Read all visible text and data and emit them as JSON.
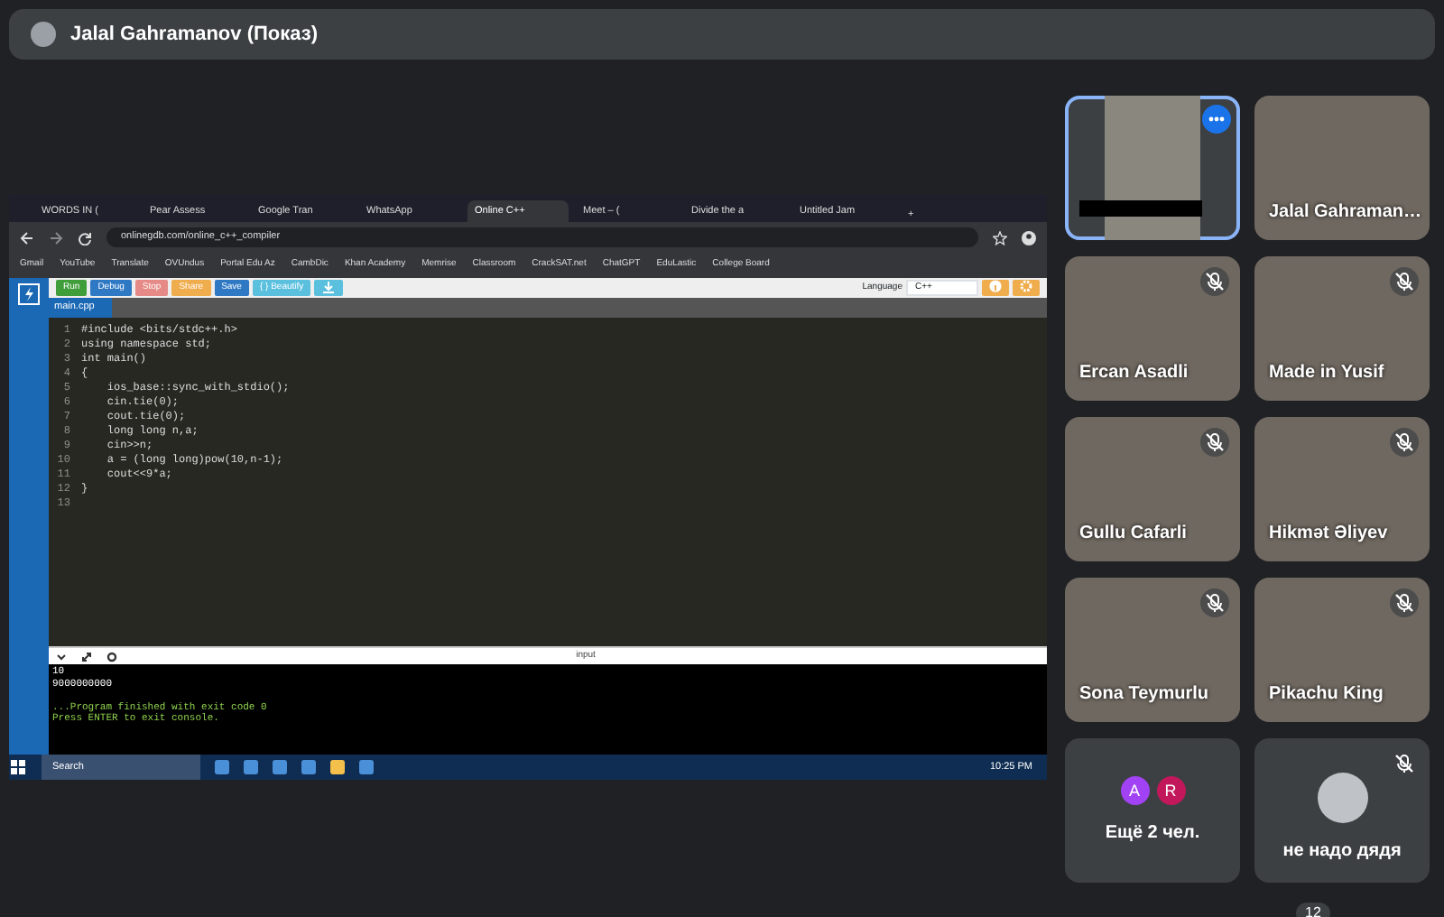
{
  "presenter_bar": {
    "title": "Jalal Gahramanov (Показ)"
  },
  "shared_screen": {
    "browser_tabs": [
      {
        "title": "WORDS IN (",
        "selected": false
      },
      {
        "title": "Pear Assess",
        "selected": false
      },
      {
        "title": "Google Tran",
        "selected": false
      },
      {
        "title": "WhatsApp",
        "selected": false
      },
      {
        "title": "Online C++",
        "selected": true
      },
      {
        "title": "Meet – (",
        "selected": false
      },
      {
        "title": "Divide the a",
        "selected": false
      },
      {
        "title": "Untitled Jam",
        "selected": false
      }
    ],
    "new_tab": "+",
    "address": "onlinegdb.com/online_c++_compiler",
    "bookmarks": [
      "Gmail",
      "YouTube",
      "Translate",
      "OVUndus",
      "Portal Edu Az",
      "CambDic",
      "Khan Academy",
      "Memrise",
      "Classroom",
      "CrackSAT.net",
      "ChatGPT",
      "EduLastic",
      "College Board"
    ],
    "toolbar_buttons": [
      {
        "label": "Run",
        "color": "#3f9e3a"
      },
      {
        "label": "Debug",
        "color": "#2f78c4"
      },
      {
        "label": "Stop",
        "color": "#e58a86"
      },
      {
        "label": "Share",
        "color": "#f0ad4e"
      },
      {
        "label": "Save",
        "color": "#2f78c4"
      },
      {
        "label": "{ } Beautify",
        "color": "#5bc0de"
      }
    ],
    "language_label": "Language",
    "language": "C++",
    "file_tab": "main.cpp",
    "code_lines": [
      {
        "number": "1",
        "text": "#include <bits/stdc++.h>"
      },
      {
        "number": "2",
        "text": "using namespace std;"
      },
      {
        "number": "3",
        "text": "int main()"
      },
      {
        "number": "4",
        "text": "{"
      },
      {
        "number": "5",
        "text": "    ios_base::sync_with_stdio();"
      },
      {
        "number": "6",
        "text": "    cin.tie(0);"
      },
      {
        "number": "7",
        "text": "    cout.tie(0);"
      },
      {
        "number": "8",
        "text": "    long long n,a;"
      },
      {
        "number": "9",
        "text": "    cin>>n;"
      },
      {
        "number": "10",
        "text": "    a = (long long)pow(10,n-1);"
      },
      {
        "number": "11",
        "text": "    cout<<9*a;"
      },
      {
        "number": "12",
        "text": "}"
      },
      {
        "number": "13"
      }
    ],
    "console_label": "input",
    "console_lines": [
      {
        "kind": "output",
        "text": "10"
      },
      {
        "kind": "output",
        "text": "9000000000"
      },
      {
        "kind": "blank"
      },
      {
        "kind": "status",
        "text": "...Program finished with exit code 0"
      },
      {
        "kind": "status",
        "text": "Press ENTER to exit console."
      }
    ],
    "taskbar": {
      "search_placeholder": "Search",
      "time": "10:25 PM"
    }
  },
  "participants": [
    {
      "kind": "video",
      "selected": true,
      "muted": false
    },
    {
      "kind": "video",
      "name": "Jalal Gahraman…",
      "selected": false,
      "muted": false
    },
    {
      "kind": "video",
      "name": "Ercan Asadli",
      "selected": false,
      "muted": true
    },
    {
      "kind": "video",
      "name": "Made in Yusif",
      "selected": false,
      "muted": true
    },
    {
      "kind": "video",
      "name": "Gullu Cafarli",
      "selected": false,
      "muted": true
    },
    {
      "kind": "video",
      "name": "Hikmət Əliyev",
      "selected": false,
      "muted": true
    },
    {
      "kind": "video",
      "name": "Sona Teymurlu",
      "selected": false,
      "muted": true
    },
    {
      "kind": "video",
      "name": "Pikachu King",
      "selected": false,
      "muted": true
    },
    {
      "kind": "more",
      "name": "Ещё 2 чел.",
      "selected": false,
      "muted": false,
      "avatars": [
        {
          "letter": "A",
          "color": "#a142f4"
        },
        {
          "letter": "R",
          "color": "#c2185b"
        }
      ]
    },
    {
      "kind": "avatar",
      "name": "не надо дядя",
      "selected": false,
      "muted": true
    }
  ],
  "participant_count": "12"
}
